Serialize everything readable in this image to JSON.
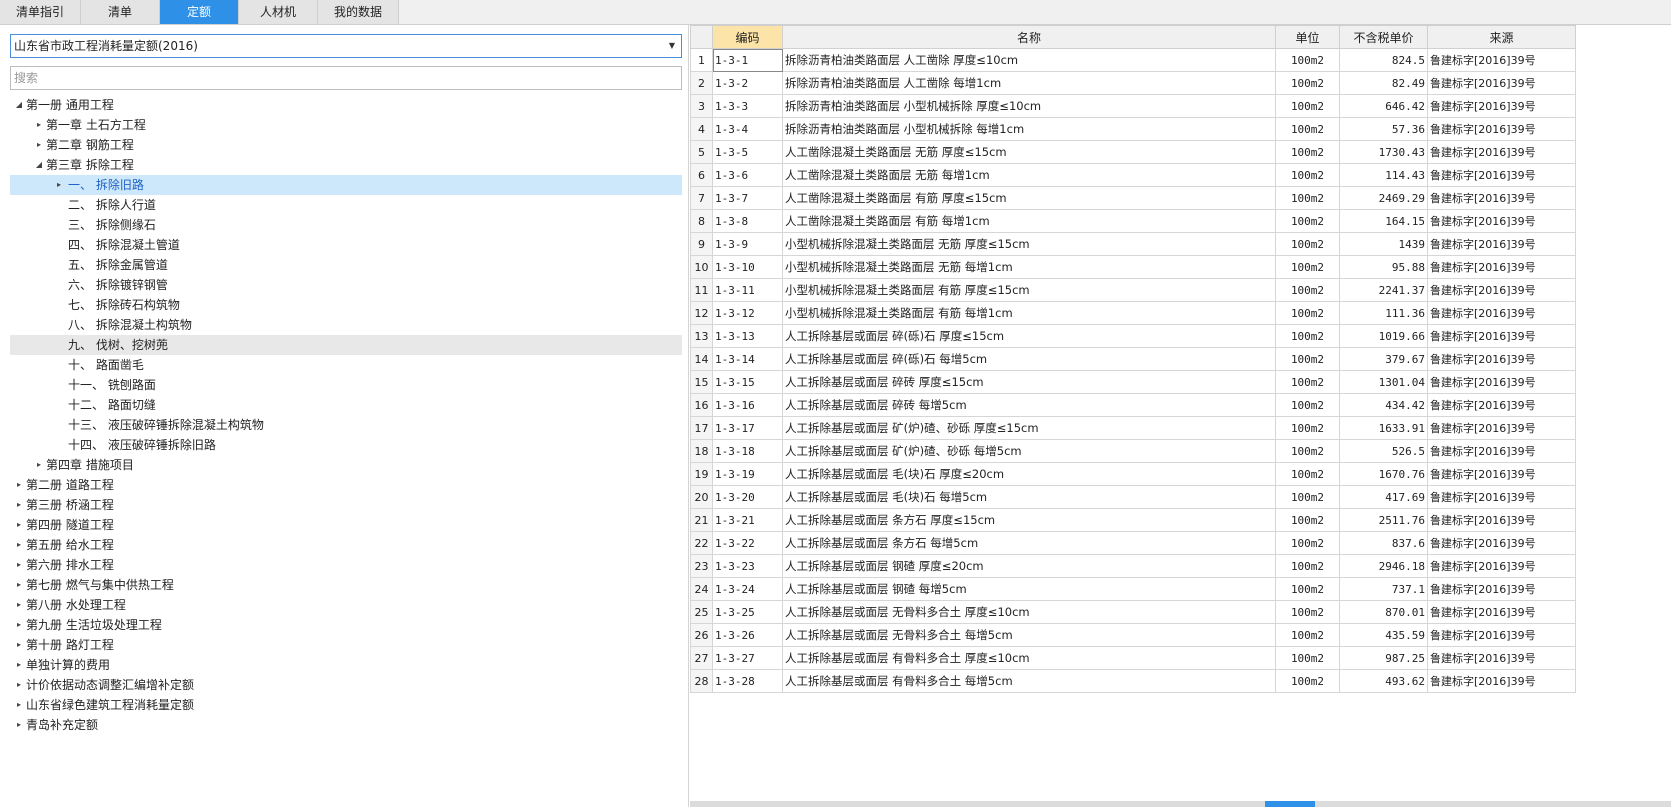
{
  "tabs": [
    {
      "label": "清单指引",
      "active": false
    },
    {
      "label": "清单",
      "active": false
    },
    {
      "label": "定额",
      "active": true
    },
    {
      "label": "人材机",
      "active": false
    },
    {
      "label": "我的数据",
      "active": false
    }
  ],
  "library_select": {
    "value": "山东省市政工程消耗量定额(2016)"
  },
  "search": {
    "placeholder": "搜索"
  },
  "tree": [
    {
      "label": "第一册 通用工程",
      "level": 0,
      "toggle": "expanded"
    },
    {
      "label": "第一章 土石方工程",
      "level": 1,
      "toggle": "collapsed"
    },
    {
      "label": "第二章 钢筋工程",
      "level": 1,
      "toggle": "collapsed"
    },
    {
      "label": "第三章 拆除工程",
      "level": 1,
      "toggle": "expanded"
    },
    {
      "label": "一、 拆除旧路",
      "level": 2,
      "toggle": "collapsed",
      "state": "selected"
    },
    {
      "label": "二、 拆除人行道",
      "level": 2,
      "toggle": "none"
    },
    {
      "label": "三、 拆除侧缘石",
      "level": 2,
      "toggle": "none"
    },
    {
      "label": "四、 拆除混凝土管道",
      "level": 2,
      "toggle": "none"
    },
    {
      "label": "五、 拆除金属管道",
      "level": 2,
      "toggle": "none"
    },
    {
      "label": "六、 拆除镀锌钢管",
      "level": 2,
      "toggle": "none"
    },
    {
      "label": "七、 拆除砖石构筑物",
      "level": 2,
      "toggle": "none"
    },
    {
      "label": "八、 拆除混凝土构筑物",
      "level": 2,
      "toggle": "none"
    },
    {
      "label": "九、 伐树、挖树蔸",
      "level": 2,
      "toggle": "none",
      "state": "hover"
    },
    {
      "label": "十、 路面凿毛",
      "level": 2,
      "toggle": "none"
    },
    {
      "label": "十一、 铣刨路面",
      "level": 2,
      "toggle": "none"
    },
    {
      "label": "十二、 路面切缝",
      "level": 2,
      "toggle": "none"
    },
    {
      "label": "十三、 液压破碎锤拆除混凝土构筑物",
      "level": 2,
      "toggle": "none"
    },
    {
      "label": "十四、 液压破碎锤拆除旧路",
      "level": 2,
      "toggle": "none"
    },
    {
      "label": "第四章 措施项目",
      "level": 1,
      "toggle": "collapsed"
    },
    {
      "label": "第二册 道路工程",
      "level": 0,
      "toggle": "collapsed"
    },
    {
      "label": "第三册 桥涵工程",
      "level": 0,
      "toggle": "collapsed"
    },
    {
      "label": "第四册 隧道工程",
      "level": 0,
      "toggle": "collapsed"
    },
    {
      "label": "第五册 给水工程",
      "level": 0,
      "toggle": "collapsed"
    },
    {
      "label": "第六册 排水工程",
      "level": 0,
      "toggle": "collapsed"
    },
    {
      "label": "第七册 燃气与集中供热工程",
      "level": 0,
      "toggle": "collapsed"
    },
    {
      "label": "第八册 水处理工程",
      "level": 0,
      "toggle": "collapsed"
    },
    {
      "label": "第九册 生活垃圾处理工程",
      "level": 0,
      "toggle": "collapsed"
    },
    {
      "label": "第十册 路灯工程",
      "level": 0,
      "toggle": "collapsed"
    },
    {
      "label": "单独计算的费用",
      "level": 0,
      "toggle": "collapsed"
    },
    {
      "label": "计价依据动态调整汇编增补定额",
      "level": 0,
      "toggle": "collapsed"
    },
    {
      "label": "山东省绿色建筑工程消耗量定额",
      "level": 0,
      "toggle": "collapsed"
    },
    {
      "label": "青岛补充定额",
      "level": 0,
      "toggle": "collapsed"
    }
  ],
  "grid": {
    "headers": {
      "code": "编码",
      "name": "名称",
      "unit": "单位",
      "price": "不含税单价",
      "source": "来源"
    },
    "rows": [
      {
        "no": "1",
        "code": "1-3-1",
        "name": "拆除沥青柏油类路面层 人工凿除 厚度≤10cm",
        "unit": "100m2",
        "price": "824.5",
        "source": "鲁建标字[2016]39号"
      },
      {
        "no": "2",
        "code": "1-3-2",
        "name": "拆除沥青柏油类路面层 人工凿除 每增1cm",
        "unit": "100m2",
        "price": "82.49",
        "source": "鲁建标字[2016]39号"
      },
      {
        "no": "3",
        "code": "1-3-3",
        "name": "拆除沥青柏油类路面层 小型机械拆除 厚度≤10cm",
        "unit": "100m2",
        "price": "646.42",
        "source": "鲁建标字[2016]39号"
      },
      {
        "no": "4",
        "code": "1-3-4",
        "name": "拆除沥青柏油类路面层 小型机械拆除 每增1cm",
        "unit": "100m2",
        "price": "57.36",
        "source": "鲁建标字[2016]39号"
      },
      {
        "no": "5",
        "code": "1-3-5",
        "name": "人工凿除混凝土类路面层 无筋 厚度≤15cm",
        "unit": "100m2",
        "price": "1730.43",
        "source": "鲁建标字[2016]39号"
      },
      {
        "no": "6",
        "code": "1-3-6",
        "name": "人工凿除混凝土类路面层 无筋 每增1cm",
        "unit": "100m2",
        "price": "114.43",
        "source": "鲁建标字[2016]39号"
      },
      {
        "no": "7",
        "code": "1-3-7",
        "name": "人工凿除混凝土类路面层 有筋 厚度≤15cm",
        "unit": "100m2",
        "price": "2469.29",
        "source": "鲁建标字[2016]39号"
      },
      {
        "no": "8",
        "code": "1-3-8",
        "name": "人工凿除混凝土类路面层 有筋 每增1cm",
        "unit": "100m2",
        "price": "164.15",
        "source": "鲁建标字[2016]39号"
      },
      {
        "no": "9",
        "code": "1-3-9",
        "name": "小型机械拆除混凝土类路面层 无筋 厚度≤15cm",
        "unit": "100m2",
        "price": "1439",
        "source": "鲁建标字[2016]39号"
      },
      {
        "no": "10",
        "code": "1-3-10",
        "name": "小型机械拆除混凝土类路面层 无筋 每增1cm",
        "unit": "100m2",
        "price": "95.88",
        "source": "鲁建标字[2016]39号"
      },
      {
        "no": "11",
        "code": "1-3-11",
        "name": "小型机械拆除混凝土类路面层 有筋 厚度≤15cm",
        "unit": "100m2",
        "price": "2241.37",
        "source": "鲁建标字[2016]39号"
      },
      {
        "no": "12",
        "code": "1-3-12",
        "name": "小型机械拆除混凝土类路面层 有筋 每增1cm",
        "unit": "100m2",
        "price": "111.36",
        "source": "鲁建标字[2016]39号"
      },
      {
        "no": "13",
        "code": "1-3-13",
        "name": "人工拆除基层或面层 碎(砾)石 厚度≤15cm",
        "unit": "100m2",
        "price": "1019.66",
        "source": "鲁建标字[2016]39号"
      },
      {
        "no": "14",
        "code": "1-3-14",
        "name": "人工拆除基层或面层 碎(砾)石 每增5cm",
        "unit": "100m2",
        "price": "379.67",
        "source": "鲁建标字[2016]39号"
      },
      {
        "no": "15",
        "code": "1-3-15",
        "name": "人工拆除基层或面层 碎砖 厚度≤15cm",
        "unit": "100m2",
        "price": "1301.04",
        "source": "鲁建标字[2016]39号"
      },
      {
        "no": "16",
        "code": "1-3-16",
        "name": "人工拆除基层或面层 碎砖 每增5cm",
        "unit": "100m2",
        "price": "434.42",
        "source": "鲁建标字[2016]39号"
      },
      {
        "no": "17",
        "code": "1-3-17",
        "name": "人工拆除基层或面层 矿(炉)碴、砂砾 厚度≤15cm",
        "unit": "100m2",
        "price": "1633.91",
        "source": "鲁建标字[2016]39号"
      },
      {
        "no": "18",
        "code": "1-3-18",
        "name": "人工拆除基层或面层 矿(炉)碴、砂砾 每增5cm",
        "unit": "100m2",
        "price": "526.5",
        "source": "鲁建标字[2016]39号"
      },
      {
        "no": "19",
        "code": "1-3-19",
        "name": "人工拆除基层或面层 毛(块)石 厚度≤20cm",
        "unit": "100m2",
        "price": "1670.76",
        "source": "鲁建标字[2016]39号"
      },
      {
        "no": "20",
        "code": "1-3-20",
        "name": "人工拆除基层或面层 毛(块)石 每增5cm",
        "unit": "100m2",
        "price": "417.69",
        "source": "鲁建标字[2016]39号"
      },
      {
        "no": "21",
        "code": "1-3-21",
        "name": "人工拆除基层或面层 条方石 厚度≤15cm",
        "unit": "100m2",
        "price": "2511.76",
        "source": "鲁建标字[2016]39号"
      },
      {
        "no": "22",
        "code": "1-3-22",
        "name": "人工拆除基层或面层 条方石 每增5cm",
        "unit": "100m2",
        "price": "837.6",
        "source": "鲁建标字[2016]39号"
      },
      {
        "no": "23",
        "code": "1-3-23",
        "name": "人工拆除基层或面层 钢碴 厚度≤20cm",
        "unit": "100m2",
        "price": "2946.18",
        "source": "鲁建标字[2016]39号"
      },
      {
        "no": "24",
        "code": "1-3-24",
        "name": "人工拆除基层或面层 钢碴 每增5cm",
        "unit": "100m2",
        "price": "737.1",
        "source": "鲁建标字[2016]39号"
      },
      {
        "no": "25",
        "code": "1-3-25",
        "name": "人工拆除基层或面层 无骨料多合土 厚度≤10cm",
        "unit": "100m2",
        "price": "870.01",
        "source": "鲁建标字[2016]39号"
      },
      {
        "no": "26",
        "code": "1-3-26",
        "name": "人工拆除基层或面层 无骨料多合土 每增5cm",
        "unit": "100m2",
        "price": "435.59",
        "source": "鲁建标字[2016]39号"
      },
      {
        "no": "27",
        "code": "1-3-27",
        "name": "人工拆除基层或面层 有骨料多合土 厚度≤10cm",
        "unit": "100m2",
        "price": "987.25",
        "source": "鲁建标字[2016]39号"
      },
      {
        "no": "28",
        "code": "1-3-28",
        "name": "人工拆除基层或面层 有骨料多合土 每增5cm",
        "unit": "100m2",
        "price": "493.62",
        "source": "鲁建标字[2016]39号"
      }
    ]
  },
  "colors": {
    "accent": "#2f90e8",
    "selected_row": "#cde8fb",
    "header_highlight": "#fce4a8"
  }
}
